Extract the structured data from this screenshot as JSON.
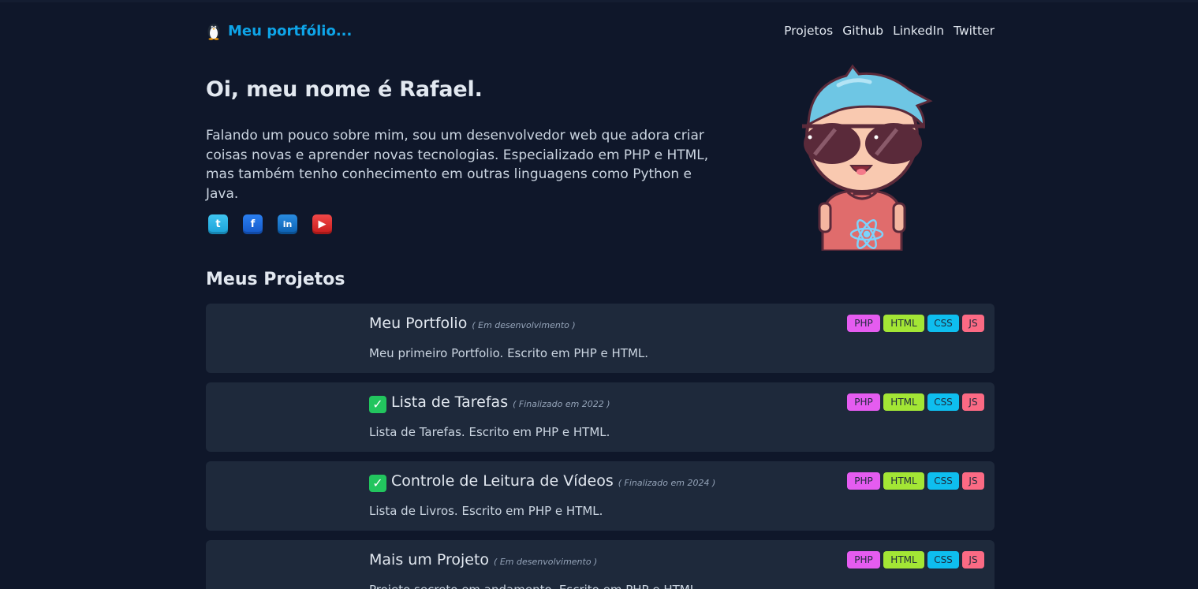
{
  "header": {
    "brand": "Meu portfólio...",
    "nav": [
      "Projetos",
      "Github",
      "LinkedIn",
      "Twitter"
    ]
  },
  "hero": {
    "title": "Oi, meu nome é Rafael.",
    "text": "Falando um pouco sobre mim, sou um desenvolvedor web que adora criar coisas novas e aprender novas tecnologias. Especializado em PHP e HTML, mas também tenho conhecimento em outras linguagens como Python e Java.",
    "socials": [
      {
        "icon": "twitter-icon",
        "glyph": "t"
      },
      {
        "icon": "facebook-icon",
        "glyph": "f"
      },
      {
        "icon": "linkedin-icon",
        "glyph": "in"
      },
      {
        "icon": "youtube-icon",
        "glyph": "▶"
      }
    ]
  },
  "projects": {
    "title": "Meus Projetos",
    "tags": [
      "PHP",
      "HTML",
      "CSS",
      "JS"
    ],
    "items": [
      {
        "name": "Meu Portfolio",
        "done": false,
        "status": "( Em desenvolvimento )",
        "desc": "Meu primeiro Portfolio. Escrito em PHP e HTML."
      },
      {
        "name": "Lista de Tarefas",
        "done": true,
        "status": "( Finalizado em 2022 )",
        "desc": "Lista de Tarefas. Escrito em PHP e HTML."
      },
      {
        "name": "Controle de Leitura de Vídeos",
        "done": true,
        "status": "( Finalizado em 2024 )",
        "desc": "Lista de Livros. Escrito em PHP e HTML."
      },
      {
        "name": "Mais um Projeto",
        "done": false,
        "status": "( Em desenvolvimento )",
        "desc": "Projeto secreto em andamento. Escrito em PHP e HTML."
      }
    ]
  },
  "colors": {
    "background": "#0f172a",
    "card": "#1e293b",
    "accent": "#0ea5e9"
  }
}
